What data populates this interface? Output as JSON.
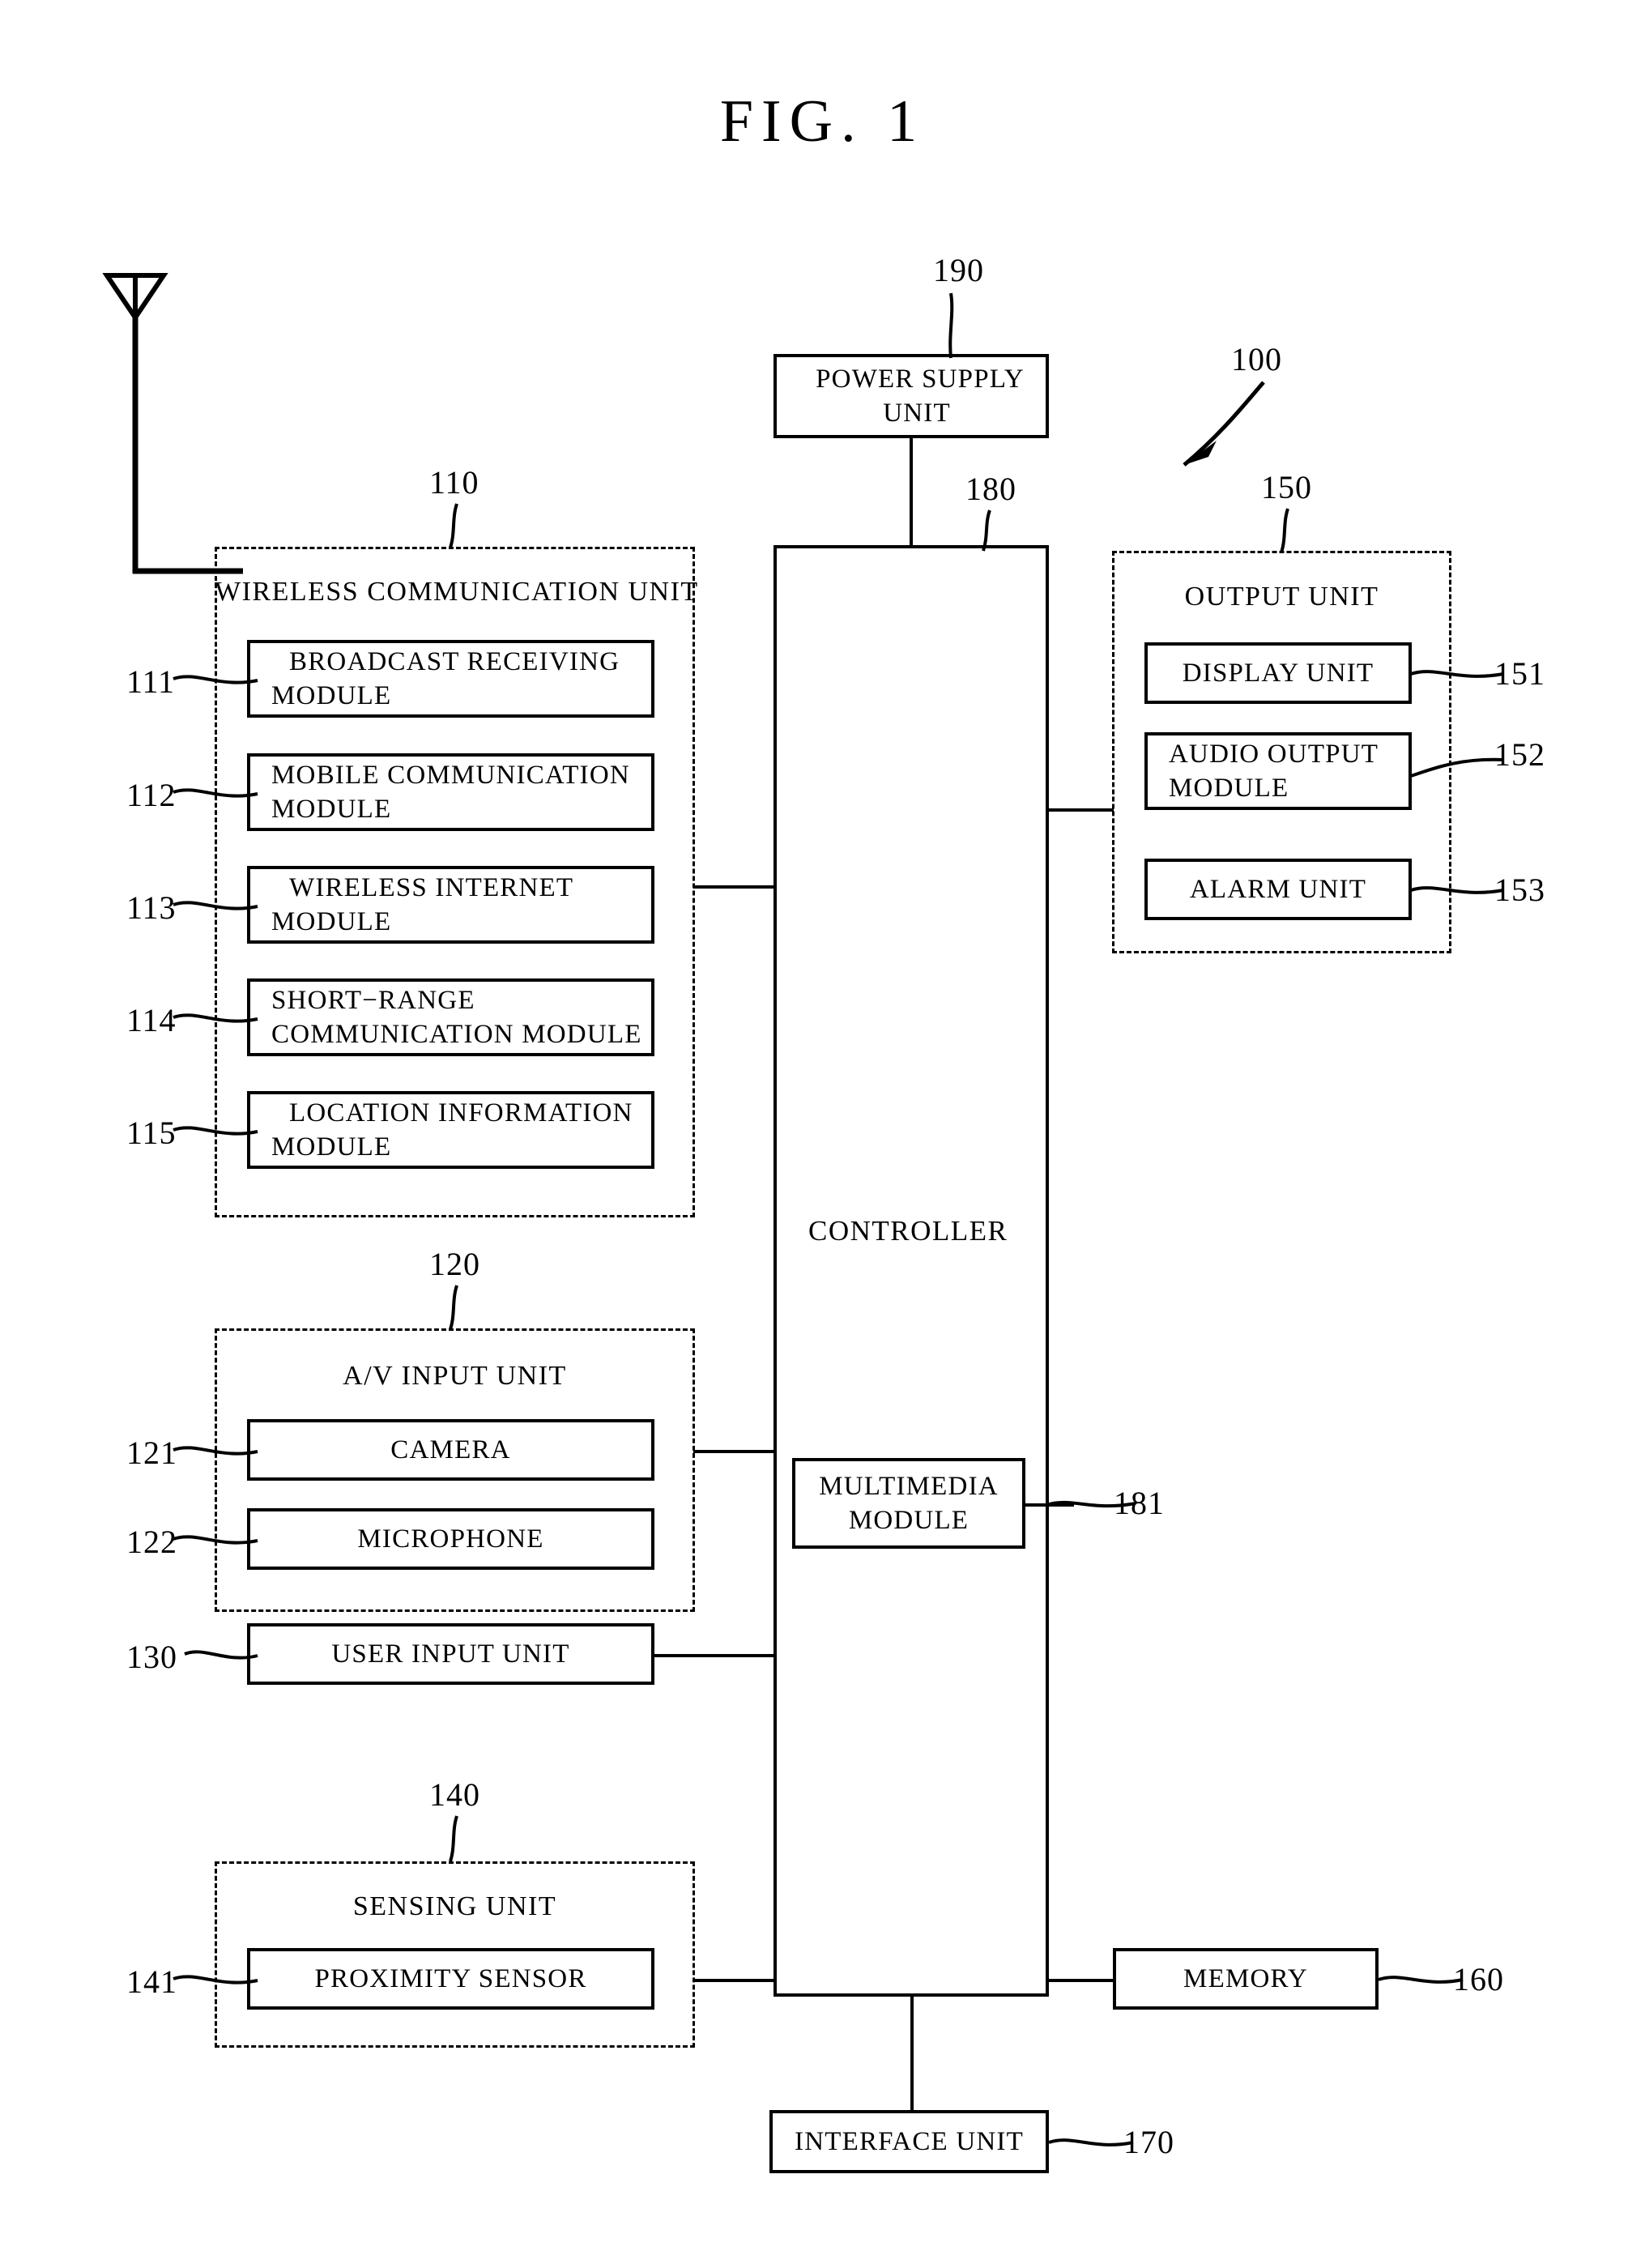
{
  "figure": {
    "title": "FIG.  1",
    "device_ref": "100"
  },
  "power_supply": {
    "label_line1": "POWER SUPPLY",
    "label_line2": "UNIT",
    "ref": "190"
  },
  "controller": {
    "label": "CONTROLLER",
    "ref": "180",
    "multimedia": {
      "label_line1": "MULTIMEDIA",
      "label_line2": "MODULE",
      "ref": "181"
    }
  },
  "wireless_communication_unit": {
    "title": "WIRELESS COMMUNICATION UNIT",
    "ref": "110",
    "modules": [
      {
        "ref": "111",
        "line1": "BROADCAST RECEIVING",
        "line2": "MODULE"
      },
      {
        "ref": "112",
        "line1": "MOBILE COMMUNICATION",
        "line2": "MODULE"
      },
      {
        "ref": "113",
        "line1": "WIRELESS INTERNET",
        "line2": "MODULE"
      },
      {
        "ref": "114",
        "line1": "SHORT−RANGE",
        "line2": "COMMUNICATION MODULE"
      },
      {
        "ref": "115",
        "line1": "LOCATION INFORMATION",
        "line2": "MODULE"
      }
    ]
  },
  "av_input_unit": {
    "title": "A/V INPUT UNIT",
    "ref": "120",
    "modules": [
      {
        "ref": "121",
        "label": "CAMERA"
      },
      {
        "ref": "122",
        "label": "MICROPHONE"
      }
    ]
  },
  "user_input_unit": {
    "label": "USER INPUT UNIT",
    "ref": "130"
  },
  "sensing_unit": {
    "title": "SENSING UNIT",
    "ref": "140",
    "modules": [
      {
        "ref": "141",
        "label": "PROXIMITY SENSOR"
      }
    ]
  },
  "output_unit": {
    "title": "OUTPUT UNIT",
    "ref": "150",
    "modules": [
      {
        "ref": "151",
        "label": "DISPLAY UNIT",
        "lines": 1
      },
      {
        "ref": "152",
        "line1": "AUDIO OUTPUT",
        "line2": "MODULE",
        "lines": 2
      },
      {
        "ref": "153",
        "label": "ALARM UNIT",
        "lines": 1
      }
    ]
  },
  "memory": {
    "label": "MEMORY",
    "ref": "160"
  },
  "interface_unit": {
    "label": "INTERFACE UNIT",
    "ref": "170"
  },
  "colors": {
    "ink": "#000000",
    "paper": "#ffffff"
  }
}
